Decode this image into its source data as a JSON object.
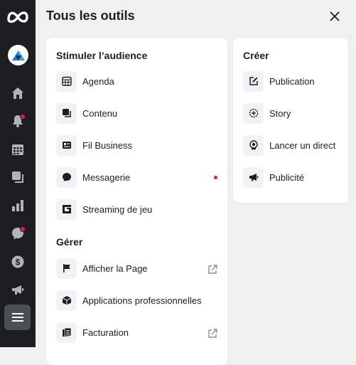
{
  "header": {
    "title": "Tous les outils"
  },
  "rail": {
    "icons": [
      "meta-logo-icon",
      "page-avatar",
      "home-icon",
      "notifications-icon",
      "planner-icon",
      "content-icon",
      "insights-icon",
      "inbox-icon",
      "monetization-icon",
      "ads-icon",
      "all-tools-menu-icon"
    ]
  },
  "sections": {
    "boost": {
      "title": "Stimuler l’audience",
      "items": [
        {
          "label": "Agenda",
          "icon": "calendar-icon"
        },
        {
          "label": "Contenu",
          "icon": "content-icon"
        },
        {
          "label": "Fil Business",
          "icon": "business-feed-icon"
        },
        {
          "label": "Messagerie",
          "icon": "messenger-icon"
        },
        {
          "label": "Streaming de jeu",
          "icon": "gaming-icon"
        }
      ]
    },
    "manage": {
      "title": "Gérer",
      "items": [
        {
          "label": "Afficher la Page",
          "icon": "flag-icon"
        },
        {
          "label": "Applications professionnelles",
          "icon": "box-icon"
        },
        {
          "label": "Facturation",
          "icon": "billing-icon"
        }
      ]
    },
    "create": {
      "title": "Créer",
      "items": [
        {
          "label": "Publication",
          "icon": "compose-icon"
        },
        {
          "label": "Story",
          "icon": "story-icon"
        },
        {
          "label": "Lancer un direct",
          "icon": "live-icon"
        },
        {
          "label": "Publicité",
          "icon": "megaphone-icon"
        }
      ]
    }
  },
  "colors": {
    "rail": "#1c1e21",
    "accent_red": "#e41e3f",
    "panel": "#f0f0f0"
  }
}
